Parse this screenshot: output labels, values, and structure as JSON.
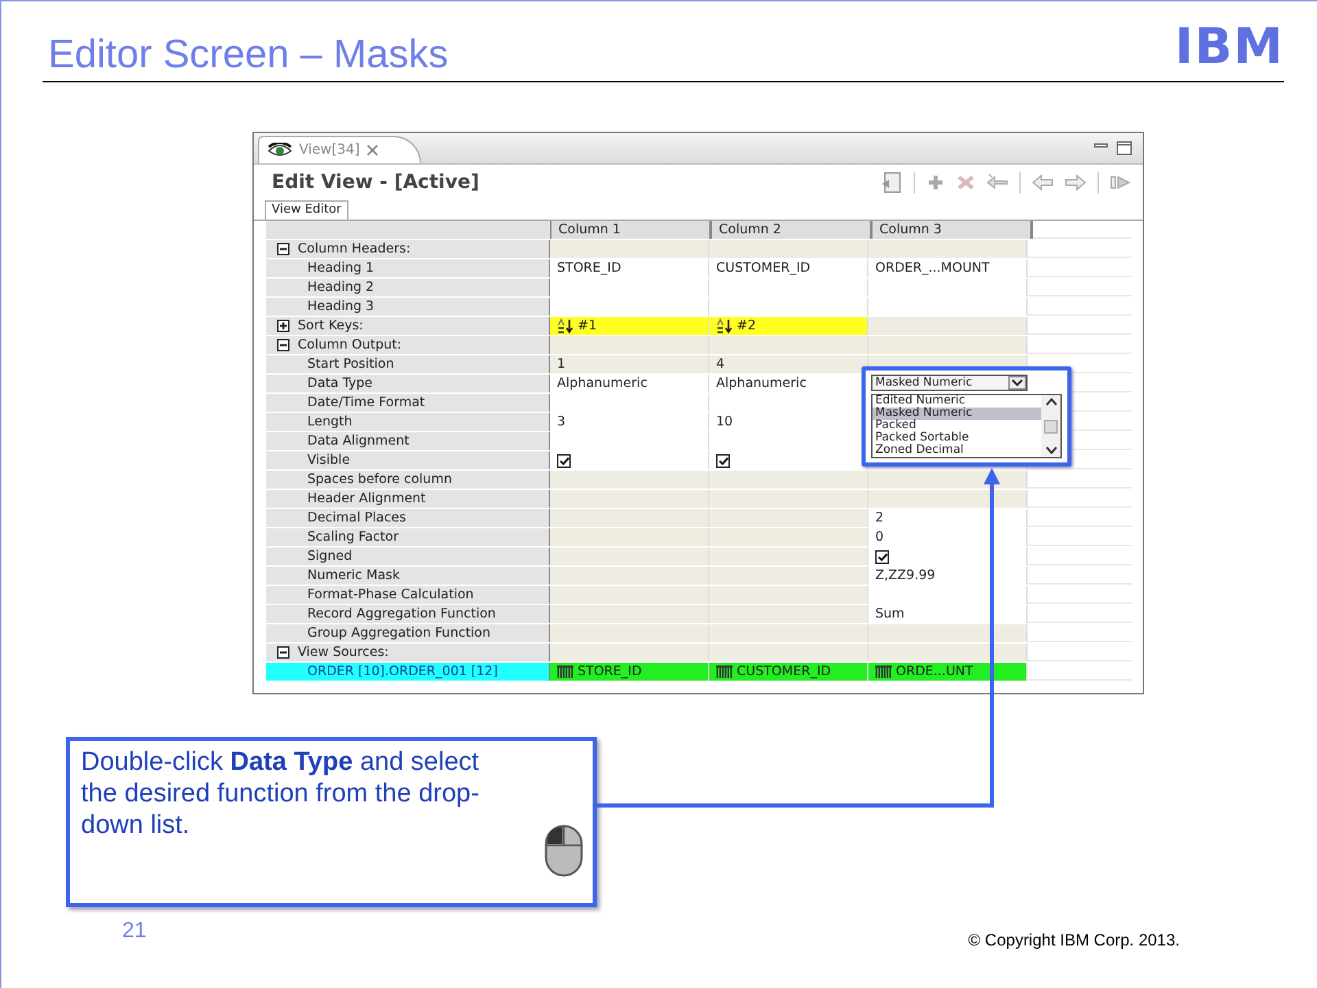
{
  "slide": {
    "title": "Editor Screen – Masks",
    "logo": "IBM",
    "page_number": "21",
    "copyright": "© Copyright  IBM Corp. 2013."
  },
  "window": {
    "tab": "View[34]",
    "title": "Edit View - [Active]",
    "subtab": "View Editor",
    "columns": [
      "Column 1",
      "Column 2",
      "Column 3"
    ],
    "rows": [
      {
        "kind": "section",
        "label": "Column Headers:",
        "expanded": true,
        "cells": [
          {
            "kind": "empty",
            "disabled": true
          },
          {
            "kind": "empty",
            "disabled": true
          },
          {
            "kind": "empty",
            "disabled": true
          }
        ]
      },
      {
        "kind": "field",
        "label": "Heading 1",
        "cells": [
          {
            "kind": "text",
            "text": "STORE_ID",
            "disabled": false
          },
          {
            "kind": "text",
            "text": "CUSTOMER_ID",
            "disabled": false
          },
          {
            "kind": "text",
            "text": "ORDER_...MOUNT",
            "disabled": false
          }
        ]
      },
      {
        "kind": "field",
        "label": "Heading 2",
        "cells": [
          {
            "kind": "empty",
            "disabled": false
          },
          {
            "kind": "empty",
            "disabled": false
          },
          {
            "kind": "empty",
            "disabled": false
          }
        ]
      },
      {
        "kind": "field",
        "label": "Heading 3",
        "cells": [
          {
            "kind": "empty",
            "disabled": false
          },
          {
            "kind": "empty",
            "disabled": false
          },
          {
            "kind": "empty",
            "disabled": false
          }
        ]
      },
      {
        "kind": "section",
        "label": "Sort Keys:",
        "expanded": false,
        "cells": [
          {
            "kind": "sort",
            "text": "#1"
          },
          {
            "kind": "sort",
            "text": "#2"
          },
          {
            "kind": "empty",
            "disabled": true
          }
        ]
      },
      {
        "kind": "section",
        "label": "Column Output:",
        "expanded": true,
        "cells": [
          {
            "kind": "empty",
            "disabled": true
          },
          {
            "kind": "empty",
            "disabled": true
          },
          {
            "kind": "empty",
            "disabled": true
          }
        ]
      },
      {
        "kind": "field",
        "label": "Start Position",
        "cells": [
          {
            "kind": "text",
            "text": "1",
            "disabled": true
          },
          {
            "kind": "text",
            "text": "4",
            "disabled": true
          },
          {
            "kind": "empty",
            "disabled": true
          }
        ]
      },
      {
        "kind": "field",
        "label": "Data Type",
        "cells": [
          {
            "kind": "text",
            "text": "Alphanumeric",
            "disabled": false
          },
          {
            "kind": "text",
            "text": "Alphanumeric",
            "disabled": false
          },
          {
            "kind": "empty"
          }
        ]
      },
      {
        "kind": "field",
        "label": "Date/Time Format",
        "cells": [
          {
            "kind": "empty",
            "disabled": false
          },
          {
            "kind": "empty",
            "disabled": false
          },
          {
            "kind": "empty"
          }
        ]
      },
      {
        "kind": "field",
        "label": "Length",
        "cells": [
          {
            "kind": "text",
            "text": "3",
            "disabled": false
          },
          {
            "kind": "text",
            "text": "10",
            "disabled": false
          },
          {
            "kind": "empty"
          }
        ]
      },
      {
        "kind": "field",
        "label": "Data Alignment",
        "cells": [
          {
            "kind": "empty",
            "disabled": false
          },
          {
            "kind": "empty",
            "disabled": false
          },
          {
            "kind": "empty"
          }
        ]
      },
      {
        "kind": "field",
        "label": "Visible",
        "cells": [
          {
            "kind": "check",
            "checked": true,
            "disabled": false
          },
          {
            "kind": "check",
            "checked": true,
            "disabled": false
          },
          {
            "kind": "empty",
            "disabled": false
          }
        ]
      },
      {
        "kind": "field",
        "label": "Spaces before column",
        "cells": [
          {
            "kind": "empty",
            "disabled": true
          },
          {
            "kind": "empty",
            "disabled": true
          },
          {
            "kind": "empty",
            "disabled": true
          }
        ]
      },
      {
        "kind": "field",
        "label": "Header Alignment",
        "cells": [
          {
            "kind": "empty",
            "disabled": true
          },
          {
            "kind": "empty",
            "disabled": true
          },
          {
            "kind": "empty",
            "disabled": true
          }
        ]
      },
      {
        "kind": "field",
        "label": "Decimal Places",
        "cells": [
          {
            "kind": "empty",
            "disabled": true
          },
          {
            "kind": "empty",
            "disabled": true
          },
          {
            "kind": "text",
            "text": "2",
            "disabled": false
          }
        ]
      },
      {
        "kind": "field",
        "label": "Scaling Factor",
        "cells": [
          {
            "kind": "empty",
            "disabled": true
          },
          {
            "kind": "empty",
            "disabled": true
          },
          {
            "kind": "text",
            "text": "0",
            "disabled": false
          }
        ]
      },
      {
        "kind": "field",
        "label": "Signed",
        "cells": [
          {
            "kind": "empty",
            "disabled": true
          },
          {
            "kind": "empty",
            "disabled": true
          },
          {
            "kind": "check",
            "checked": true,
            "disabled": false
          }
        ]
      },
      {
        "kind": "field",
        "label": "Numeric Mask",
        "cells": [
          {
            "kind": "empty",
            "disabled": true
          },
          {
            "kind": "empty",
            "disabled": true
          },
          {
            "kind": "text",
            "text": "Z,ZZ9.99",
            "disabled": false
          }
        ]
      },
      {
        "kind": "field",
        "label": "Format-Phase Calculation",
        "cells": [
          {
            "kind": "empty",
            "disabled": true
          },
          {
            "kind": "empty",
            "disabled": true
          },
          {
            "kind": "empty",
            "disabled": false
          }
        ]
      },
      {
        "kind": "field",
        "label": "Record Aggregation Function",
        "cells": [
          {
            "kind": "empty",
            "disabled": true
          },
          {
            "kind": "empty",
            "disabled": true
          },
          {
            "kind": "text",
            "text": "Sum",
            "disabled": false
          }
        ]
      },
      {
        "kind": "field",
        "label": "Group Aggregation Function",
        "cells": [
          {
            "kind": "empty",
            "disabled": true
          },
          {
            "kind": "empty",
            "disabled": true
          },
          {
            "kind": "empty",
            "disabled": true
          }
        ]
      },
      {
        "kind": "section",
        "label": "View Sources:",
        "expanded": true,
        "cells": [
          {
            "kind": "empty",
            "disabled": true
          },
          {
            "kind": "empty",
            "disabled": true
          },
          {
            "kind": "empty",
            "disabled": true
          }
        ]
      },
      {
        "kind": "source",
        "label": "ORDER [10].ORDER_001 [12]",
        "cells": [
          {
            "kind": "source",
            "text": "STORE_ID"
          },
          {
            "kind": "source",
            "text": "CUSTOMER_ID"
          },
          {
            "kind": "source",
            "text": "ORDE...UNT"
          }
        ]
      }
    ],
    "dropdown": {
      "value": "Masked Numeric",
      "options": [
        {
          "label": "Edited Numeric",
          "selected": false
        },
        {
          "label": "Masked Numeric",
          "selected": true
        },
        {
          "label": "Packed",
          "selected": false
        },
        {
          "label": "Packed Sortable",
          "selected": false
        },
        {
          "label": "Zoned Decimal",
          "selected": false
        }
      ]
    }
  },
  "callout": {
    "text": "Double-click **Data Type** and select the desired function from the drop-down list."
  }
}
